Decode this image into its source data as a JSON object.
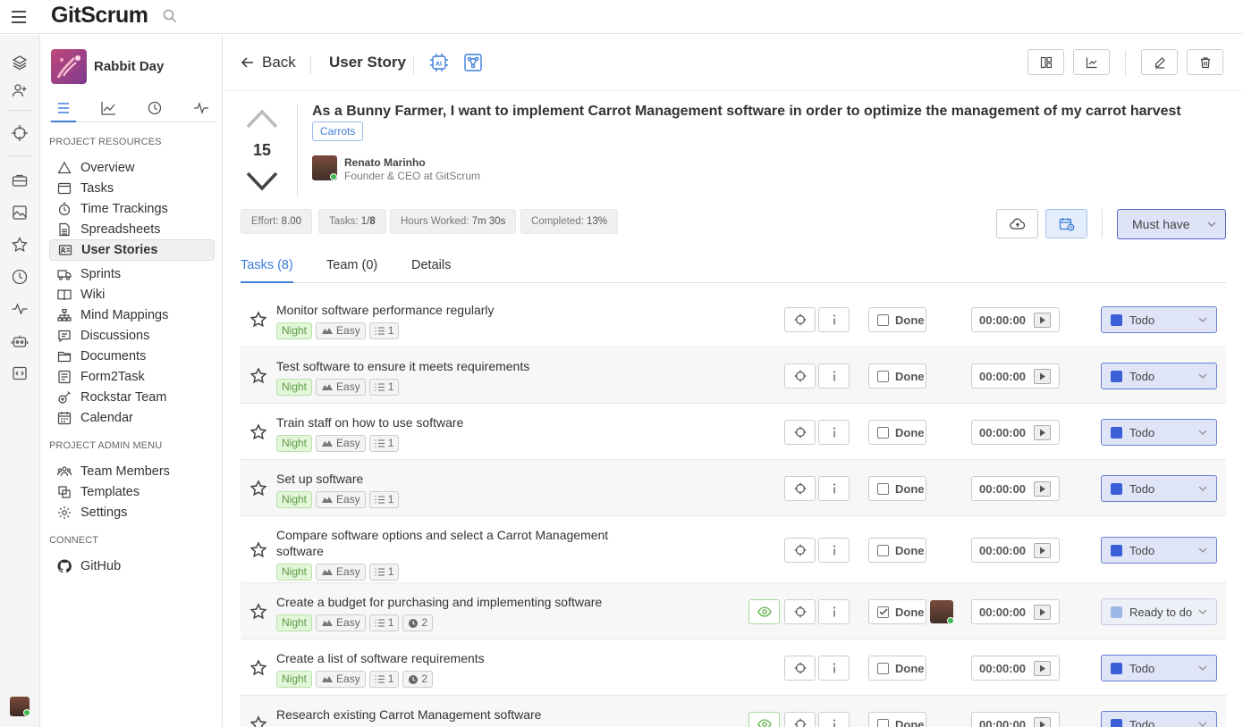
{
  "app": {
    "logo": "GitScrum"
  },
  "project": {
    "name": "Rabbit Day"
  },
  "sidebar": {
    "resources_heading": "PROJECT RESOURCES",
    "items": [
      {
        "label": "Overview",
        "icon": "triangle-icon"
      },
      {
        "label": "Tasks",
        "icon": "task-card-icon"
      },
      {
        "label": "Time Trackings",
        "icon": "stopwatch-icon"
      },
      {
        "label": "Spreadsheets",
        "icon": "spreadsheet-icon"
      },
      {
        "label": "User Stories",
        "icon": "user-stories-icon"
      },
      {
        "label": "Sprints",
        "icon": "truck-icon"
      },
      {
        "label": "Wiki",
        "icon": "book-icon"
      },
      {
        "label": "Mind Mappings",
        "icon": "hierarchy-icon"
      },
      {
        "label": "Discussions",
        "icon": "message-icon"
      },
      {
        "label": "Documents",
        "icon": "folder-icon"
      },
      {
        "label": "Form2Task",
        "icon": "form-icon"
      },
      {
        "label": "Rockstar Team",
        "icon": "guitar-icon"
      },
      {
        "label": "Calendar",
        "icon": "calendar-icon"
      }
    ],
    "admin_heading": "PROJECT ADMIN MENU",
    "admin_items": [
      {
        "label": "Team Members",
        "icon": "team-icon"
      },
      {
        "label": "Templates",
        "icon": "templates-icon"
      },
      {
        "label": "Settings",
        "icon": "gear-icon"
      }
    ],
    "connect_heading": "CONNECT",
    "connect_items": [
      {
        "label": "GitHub",
        "icon": "github-icon"
      }
    ]
  },
  "header": {
    "back_label": "Back",
    "title": "User Story"
  },
  "story": {
    "votes": "15",
    "title": "As a Bunny Farmer, I want to implement Carrot Management software in order to optimize the management of my carrot harvest",
    "tag": "Carrots",
    "author_name": "Renato Marinho",
    "author_role": "Founder & CEO at GitScrum",
    "stats": {
      "effort_label": "Effort:",
      "effort_value": "8.00",
      "tasks_label": "Tasks:",
      "tasks_value_done": "1/",
      "tasks_value_total": "8",
      "hours_label": "Hours Worked:",
      "hours_value": "7m 30s",
      "completed_label": "Completed:",
      "completed_value": "13%"
    },
    "priority": "Must have"
  },
  "tabs": [
    "Tasks (8)",
    "Team (0)",
    "Details"
  ],
  "colors": {
    "accent": "#3d7dd8",
    "todo": "#3b5fd6",
    "ready": "#9cb8e8",
    "night": "#5e9c46"
  },
  "tasks": [
    {
      "title": "Monitor software performance regularly",
      "tag": "Night",
      "effort": "Easy",
      "subtasks": "1",
      "done_label": "Done",
      "timer": "00:00:00",
      "status": "Todo"
    },
    {
      "title": "Test software to ensure it meets requirements",
      "tag": "Night",
      "effort": "Easy",
      "subtasks": "1",
      "done_label": "Done",
      "timer": "00:00:00",
      "status": "Todo"
    },
    {
      "title": "Train staff on how to use software",
      "tag": "Night",
      "effort": "Easy",
      "subtasks": "1",
      "done_label": "Done",
      "timer": "00:00:00",
      "status": "Todo"
    },
    {
      "title": "Set up software",
      "tag": "Night",
      "effort": "Easy",
      "subtasks": "1",
      "done_label": "Done",
      "timer": "00:00:00",
      "status": "Todo"
    },
    {
      "title": "Compare software options and select a Carrot Management software",
      "tag": "Night",
      "effort": "Easy",
      "subtasks": "1",
      "done_label": "Done",
      "timer": "00:00:00",
      "status": "Todo"
    },
    {
      "title": "Create a budget for purchasing and implementing software",
      "tag": "Night",
      "effort": "Easy",
      "subtasks": "1",
      "time_entries": "2",
      "done_label": "Done",
      "timer": "00:00:00",
      "status": "Ready to do"
    },
    {
      "title": "Create a list of software requirements",
      "tag": "Night",
      "effort": "Easy",
      "subtasks": "1",
      "time_entries": "2",
      "done_label": "Done",
      "timer": "00:00:00",
      "status": "Todo"
    },
    {
      "title": "Research existing Carrot Management software",
      "done_label": "Done",
      "timer": "00:00:00",
      "status": "Todo"
    }
  ]
}
